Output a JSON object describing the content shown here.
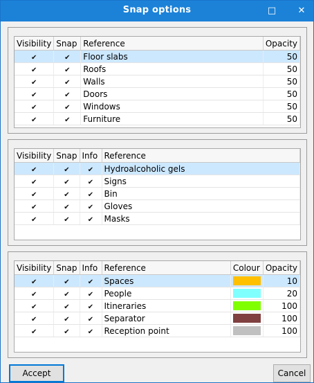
{
  "window": {
    "title": "Snap options",
    "maximize_glyph": "□",
    "close_glyph": "✕"
  },
  "table1": {
    "headers": [
      "Visibility",
      "Snap",
      "Reference",
      "Opacity"
    ],
    "rows": [
      {
        "ref": "Floor slabs",
        "opacity": "50",
        "visibility": true,
        "snap": true,
        "selected": true
      },
      {
        "ref": "Roofs",
        "opacity": "50",
        "visibility": true,
        "snap": true
      },
      {
        "ref": "Walls",
        "opacity": "50",
        "visibility": true,
        "snap": true
      },
      {
        "ref": "Doors",
        "opacity": "50",
        "visibility": true,
        "snap": true
      },
      {
        "ref": "Windows",
        "opacity": "50",
        "visibility": true,
        "snap": true
      },
      {
        "ref": "Furniture",
        "opacity": "50",
        "visibility": true,
        "snap": true
      }
    ]
  },
  "table2": {
    "headers": [
      "Visibility",
      "Snap",
      "Info",
      "Reference"
    ],
    "rows": [
      {
        "ref": "Hydroalcoholic gels",
        "visibility": true,
        "snap": true,
        "info": true,
        "selected": true
      },
      {
        "ref": "Signs",
        "visibility": true,
        "snap": true,
        "info": true
      },
      {
        "ref": "Bin",
        "visibility": true,
        "snap": true,
        "info": true
      },
      {
        "ref": "Gloves",
        "visibility": true,
        "snap": true,
        "info": true
      },
      {
        "ref": "Masks",
        "visibility": true,
        "snap": true,
        "info": true
      }
    ]
  },
  "table3": {
    "headers": [
      "Visibility",
      "Snap",
      "Info",
      "Reference",
      "Colour",
      "Opacity"
    ],
    "rows": [
      {
        "ref": "Spaces",
        "colour": "#ffc000",
        "opacity": "10",
        "visibility": true,
        "snap": true,
        "info": true,
        "selected": true
      },
      {
        "ref": "People",
        "colour": "#80ffff",
        "opacity": "20",
        "visibility": true,
        "snap": true,
        "info": true
      },
      {
        "ref": "Itineraries",
        "colour": "#80ff00",
        "opacity": "100",
        "visibility": true,
        "snap": true,
        "info": true
      },
      {
        "ref": "Separator",
        "colour": "#804040",
        "opacity": "100",
        "visibility": true,
        "snap": true,
        "info": true
      },
      {
        "ref": "Reception point",
        "colour": "#c0c0c0",
        "opacity": "100",
        "visibility": true,
        "snap": true,
        "info": true
      }
    ]
  },
  "buttons": {
    "accept": "Accept",
    "cancel": "Cancel"
  },
  "checkbox_glyph": "✔"
}
